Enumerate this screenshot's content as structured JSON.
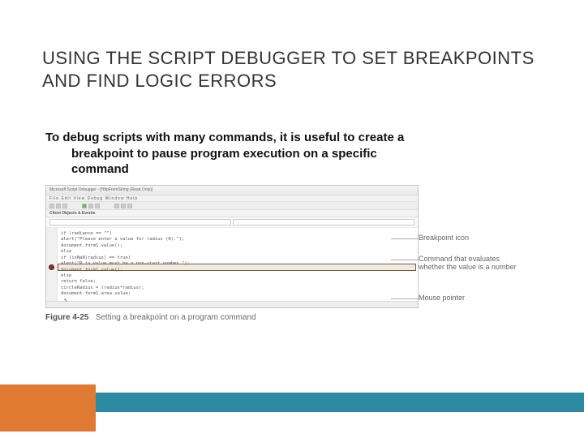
{
  "title": "USING THE SCRIPT DEBUGGER TO SET BREAKPOINTS AND FIND LOGIC ERRORS",
  "body": {
    "line1": "To debug scripts with many commands, it is useful to create a",
    "line2": "breakpoint to pause program execution on a specific",
    "line3": "command"
  },
  "ide": {
    "window_title": "Microsoft Script Debugger - [HttpFromString (Read Only)]",
    "menu": "File  Edit  View  Debug  Window  Help",
    "panel_label": "Client Objects & Events",
    "code_lines": [
      "if (radiance == \"\")",
      "  alert(\"Please enter a value for radius (R).\");",
      "  document.form1.value();",
      "else",
      "  if (isNaN(radius) == true)",
      "    alert(\"R is value must be a non-start number.\");",
      "    document.form1.value();",
      "  else",
      "    return false;",
      "circleRadius = (radius*radius);",
      "document.form1.area.value;"
    ],
    "highlight_index": 4
  },
  "callouts": {
    "c1": "Breakpoint icon",
    "c2": "Command that evaluates whether the value is a number",
    "c3": "Mouse pointer"
  },
  "figure": {
    "label": "Figure 4-25",
    "caption": "Setting a breakpoint on a program command"
  }
}
